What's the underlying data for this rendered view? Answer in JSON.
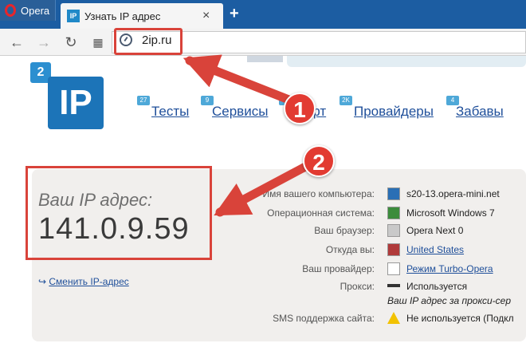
{
  "browser": {
    "opera_label": "Opera",
    "tab_title": "Узнать IP адрес",
    "tab_favicon": "IP",
    "tab_close": "×",
    "new_tab": "+",
    "url": "2ip.ru",
    "icons": [
      "back-icon",
      "forward-icon",
      "reload-icon",
      "speed-dial-icon",
      "site-info-icon"
    ]
  },
  "site": {
    "logo_small": "2",
    "logo_big": "IP",
    "nav": [
      {
        "label": "Тесты",
        "badge": "27"
      },
      {
        "label": "Сервисы",
        "badge": "9"
      },
      {
        "label": "Софт",
        "badge": "6"
      },
      {
        "label": "Провайдеры",
        "badge": "2K"
      },
      {
        "label": "Забавы",
        "badge": "4"
      }
    ]
  },
  "ip_block": {
    "label": "Ваш IP адрес:",
    "value": "141.0.9.59",
    "change_link": "Сменить IP-адрес"
  },
  "info": [
    {
      "label": "Имя вашего компьютера:",
      "value": "s20-13.opera-mini.net",
      "icon": "computer-icon"
    },
    {
      "label": "Операционная система:",
      "value": "Microsoft Windows 7",
      "icon": "windows-icon"
    },
    {
      "label": "Ваш браузер:",
      "value": "Opera Next 0",
      "icon": "browser-icon"
    },
    {
      "label": "Откуда вы:",
      "value": "United States",
      "icon": "us-flag-icon",
      "link": true
    },
    {
      "label": "Ваш провайдер:",
      "value": "Режим Turbo-Opera",
      "icon": "provider-icon",
      "link": true
    },
    {
      "label": "Прокси:",
      "value": "Используется",
      "icon": "glasses-icon"
    },
    {
      "label": "",
      "value": "Ваш IP адрес за прокси-сер",
      "icon": ""
    },
    {
      "label": "SMS поддержка сайта:",
      "value": "Не используется (Подкл",
      "icon": "warning-icon"
    }
  ],
  "annotations": {
    "step1": "1",
    "step2": "2"
  },
  "colors": {
    "accent_red": "#d9433a",
    "tabbar": "#1c5da2",
    "link": "#1f4f9a"
  }
}
